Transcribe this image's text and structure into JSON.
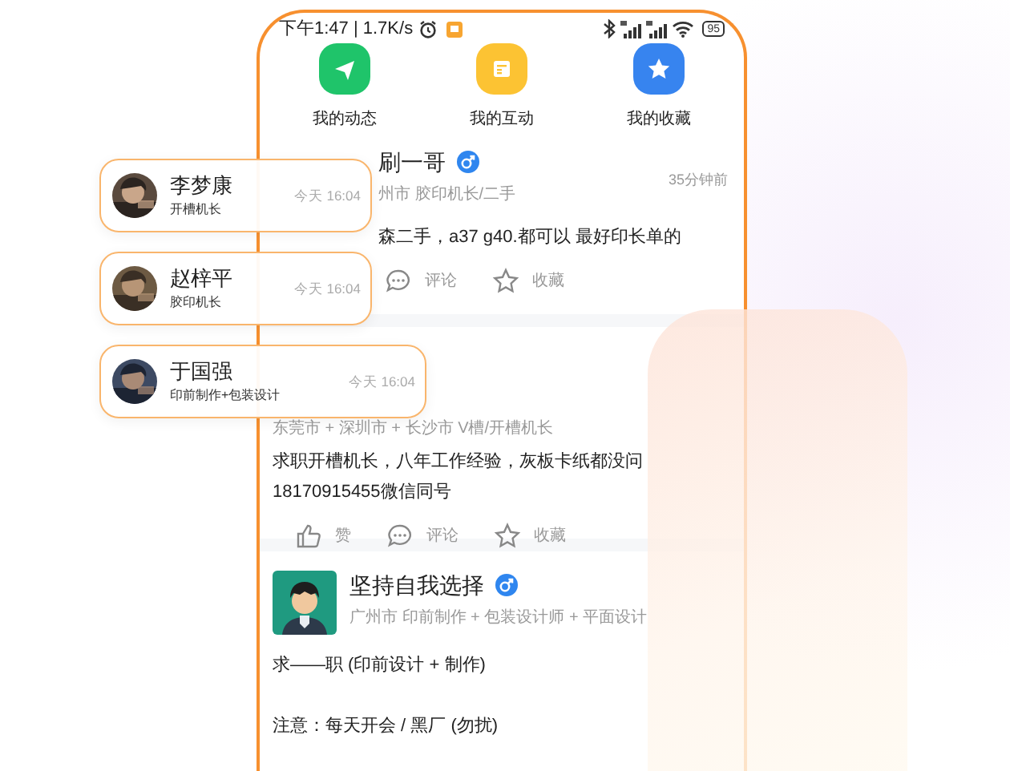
{
  "status_bar": {
    "time": "下午1:47 | 1.7K/s",
    "battery": "95"
  },
  "shortcuts": [
    {
      "kind": "send",
      "label": "我的动态"
    },
    {
      "kind": "message",
      "label": "我的互动"
    },
    {
      "kind": "star",
      "label": "我的收藏"
    }
  ],
  "posts": [
    {
      "name": "刷一哥",
      "male": true,
      "location": "州市 胶印机长/二手",
      "time": "35分钟前",
      "content": [
        [
          "森二手，a37  g40.都可以  最好印长单的"
        ]
      ],
      "actions": [
        {
          "kind": "comment",
          "label": "评论"
        },
        {
          "kind": "favorite",
          "label": "收藏"
        }
      ]
    },
    {
      "location": "东莞市 + 深圳市 + 长沙市 V槽/开槽机长",
      "content": [
        [
          "求职开槽机长，八年工作经验，灰板卡纸都没问",
          "18170915455微信同号"
        ]
      ],
      "actions": [
        {
          "kind": "like",
          "label": "赞"
        },
        {
          "kind": "comment",
          "label": "评论"
        },
        {
          "kind": "favorite",
          "label": "收藏"
        }
      ]
    },
    {
      "avatar": true,
      "name": "坚持自我选择",
      "male": true,
      "location": "广州市 印前制作 + 包装设计师 + 平面设计",
      "content": [
        [
          "求——职 (印前设计 + 制作)"
        ],
        [
          "注意：每天开会 / 黑厂 (勿扰)"
        ]
      ]
    }
  ],
  "floating_cards": [
    {
      "name": "李梦康",
      "role": "开槽机长",
      "time": "今天 16:04"
    },
    {
      "name": "赵梓平",
      "role": "胶印机长",
      "time": "今天 16:04"
    },
    {
      "name": "于国强",
      "role": "印前制作+包装设计",
      "time": "今天 16:04"
    }
  ]
}
